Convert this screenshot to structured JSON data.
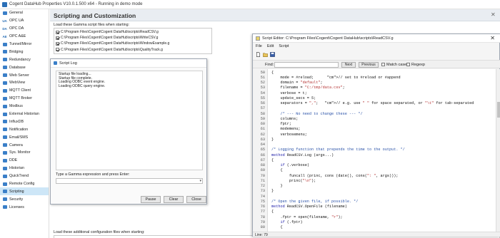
{
  "window": {
    "title": "Cogent DataHub Properties V10.0.1.500 x64 - Running in demo mode"
  },
  "sidebar": {
    "items": [
      {
        "label": "General",
        "icon": "general-icon"
      },
      {
        "label": "OPC UA",
        "icon": "opc-ua-icon",
        "badge": "UA"
      },
      {
        "label": "OPC DA",
        "icon": "opc-da-icon",
        "badge": "DA"
      },
      {
        "label": "OPC A&E",
        "icon": "opc-ae-icon",
        "badge": "AE"
      },
      {
        "label": "Tunnel/Mirror",
        "icon": "tunnel-icon"
      },
      {
        "label": "Bridging",
        "icon": "bridging-icon"
      },
      {
        "label": "Redundancy",
        "icon": "redundancy-icon"
      },
      {
        "label": "Database",
        "icon": "database-icon"
      },
      {
        "label": "Web Server",
        "icon": "web-server-icon"
      },
      {
        "label": "WebView",
        "icon": "webview-icon"
      },
      {
        "label": "MQTT Client",
        "icon": "mqtt-client-icon"
      },
      {
        "label": "MQTT Broker",
        "icon": "mqtt-broker-icon"
      },
      {
        "label": "Modbus",
        "icon": "modbus-icon"
      },
      {
        "label": "External Historian",
        "icon": "external-historian-icon"
      },
      {
        "label": "InfluxDB",
        "icon": "influxdb-icon"
      },
      {
        "label": "Notification",
        "icon": "notification-icon"
      },
      {
        "label": "Email/SMS",
        "icon": "email-icon"
      },
      {
        "label": "Camera",
        "icon": "camera-icon"
      },
      {
        "label": "Sys. Monitor",
        "icon": "sys-monitor-icon"
      },
      {
        "label": "DDE",
        "icon": "dde-icon"
      },
      {
        "label": "Historian",
        "icon": "historian-icon"
      },
      {
        "label": "QuickTrend",
        "icon": "quicktrend-icon"
      },
      {
        "label": "Remote Config",
        "icon": "remote-config-icon"
      },
      {
        "label": "Scripting",
        "icon": "scripting-icon",
        "selected": true
      },
      {
        "label": "Security",
        "icon": "security-icon"
      },
      {
        "label": "Licenses",
        "icon": "licenses-icon"
      }
    ]
  },
  "panel": {
    "title": "Scripting and Customization",
    "load_files_label": "Load these Gamma script files when starting:",
    "files": [
      "C:\\Program Files\\Cogent\\Cogent DataHub\\scripts\\ReadCSV.g",
      "C:\\Program Files\\Cogent\\Cogent DataHub\\scripts\\WriteCSV.g",
      "C:\\Program Files\\Cogent\\Cogent DataHub\\scripts\\WindowExample.g",
      "C:\\Program Files\\Cogent\\Cogent DataHub\\scripts\\QualityTrack.g"
    ],
    "load_config_label": "Load these additional configuration files when starting:"
  },
  "script_log": {
    "title": "Script Log",
    "lines": [
      "Startup file loading...",
      "Startup file complete.",
      "Loading ODBC event engine.",
      "Loading ODBC query engine."
    ],
    "expr_label": "Type a Gamma expression and press Enter:",
    "expr_value": "",
    "pause_label": "Pause",
    "clear_label": "Clear",
    "close_label": "Close"
  },
  "editor": {
    "title": "Script Editor: C:\\Program Files\\Cogent\\Cogent DataHub\\scripts\\ReadCSV.g",
    "menu": [
      "File",
      "Edit",
      "Script"
    ],
    "find_label": "Find:",
    "find_value": "",
    "next_label": "Next",
    "previous_label": "Previous",
    "match_case_label": "Match case",
    "regexp_label": "Regexp",
    "status_line": "Line: 79",
    "code": [
      {
        "n": "50",
        "t": "{"
      },
      {
        "n": "51",
        "t": "    mode = #reload;      // set to #reload or #append"
      },
      {
        "n": "52",
        "t": "    domain = \"default\";"
      },
      {
        "n": "53",
        "t": "    filename = \"C:/tmp/data.csv\";"
      },
      {
        "n": "54",
        "t": "    verbose = t;"
      },
      {
        "n": "55",
        "t": "    update_secs = 5;"
      },
      {
        "n": "56",
        "t": "    separators = \",\";   // e.g. use \" \" for space separated, or \"\\t\" for tab-separated"
      },
      {
        "n": "57",
        "t": ""
      },
      {
        "n": "58",
        "t": "    /* --- No need to change these --- */"
      },
      {
        "n": "59",
        "t": "    columns;"
      },
      {
        "n": "60",
        "t": "    fptr;"
      },
      {
        "n": "61",
        "t": "    modemenu;"
      },
      {
        "n": "62",
        "t": "    verbosemenu;"
      },
      {
        "n": "63",
        "t": "}"
      },
      {
        "n": "64",
        "t": ""
      },
      {
        "n": "65",
        "t": "/* Logging function that prepends the time to the output. */"
      },
      {
        "n": "66",
        "t": "method ReadCSV.Log (args...)"
      },
      {
        "n": "67",
        "t": "{"
      },
      {
        "n": "68",
        "t": "    if (.verbose)"
      },
      {
        "n": "69",
        "t": "    {"
      },
      {
        "n": "70",
        "t": "        funcall (princ, cons (date(), cons(\": \", args)));"
      },
      {
        "n": "71",
        "t": "        princ(\"\\n\");"
      },
      {
        "n": "72",
        "t": "    }"
      },
      {
        "n": "73",
        "t": "}"
      },
      {
        "n": "74",
        "t": ""
      },
      {
        "n": "75",
        "t": "/* Open the given file, if possible. */"
      },
      {
        "n": "76",
        "t": "method ReadCSV.OpenFile (filename)"
      },
      {
        "n": "77",
        "t": "{"
      },
      {
        "n": "78",
        "t": "    .fptr = open(filename, \"r\");"
      },
      {
        "n": "79",
        "t": "    if (.fptr)"
      },
      {
        "n": "80",
        "t": "    {"
      }
    ]
  },
  "colors": {
    "selection": "#cde6f7",
    "accent": "#2a6fb7",
    "code_keyword": "#1c1ca8",
    "code_comment": "#2a52a8",
    "code_string": "#b53232"
  }
}
